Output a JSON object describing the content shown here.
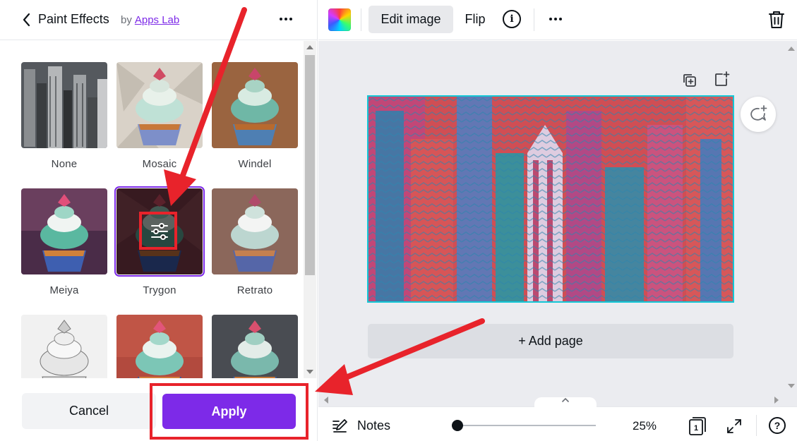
{
  "panel": {
    "title": "Paint Effects",
    "by_prefix": "by",
    "by_link": "Apps Lab",
    "effects": [
      {
        "label": "None",
        "thumb": "city"
      },
      {
        "label": "Mosaic",
        "thumb": "mosaic"
      },
      {
        "label": "Windel",
        "thumb": "windel"
      },
      {
        "label": "Meiya",
        "thumb": "meiya"
      },
      {
        "label": "Trygon",
        "thumb": "trygon",
        "selected": true
      },
      {
        "label": "Retrato",
        "thumb": "retrato"
      },
      {
        "label": "",
        "thumb": "sketch"
      },
      {
        "label": "",
        "thumb": "red"
      },
      {
        "label": "",
        "thumb": "dark"
      }
    ],
    "cancel_label": "Cancel",
    "apply_label": "Apply"
  },
  "toolbar": {
    "edit_image_label": "Edit image",
    "flip_label": "Flip",
    "info_glyph": "i"
  },
  "canvas": {
    "add_page_label": "+ Add page"
  },
  "bottom": {
    "notes_label": "Notes",
    "zoom_label": "25%",
    "zoom_value": 0.04,
    "page_count": "1",
    "help_glyph": "?"
  },
  "colors": {
    "accent": "#7d2ae8",
    "selection": "#13c7d6",
    "annotation": "#e8232b"
  },
  "icons": [
    "chevron-left-icon",
    "more-icon",
    "color-palette-icon",
    "info-icon",
    "trash-icon",
    "duplicate-page-icon",
    "add-page-icon",
    "comment-add-icon",
    "settings-sliders-icon",
    "notes-icon",
    "pages-icon",
    "fullscreen-icon",
    "help-icon"
  ]
}
